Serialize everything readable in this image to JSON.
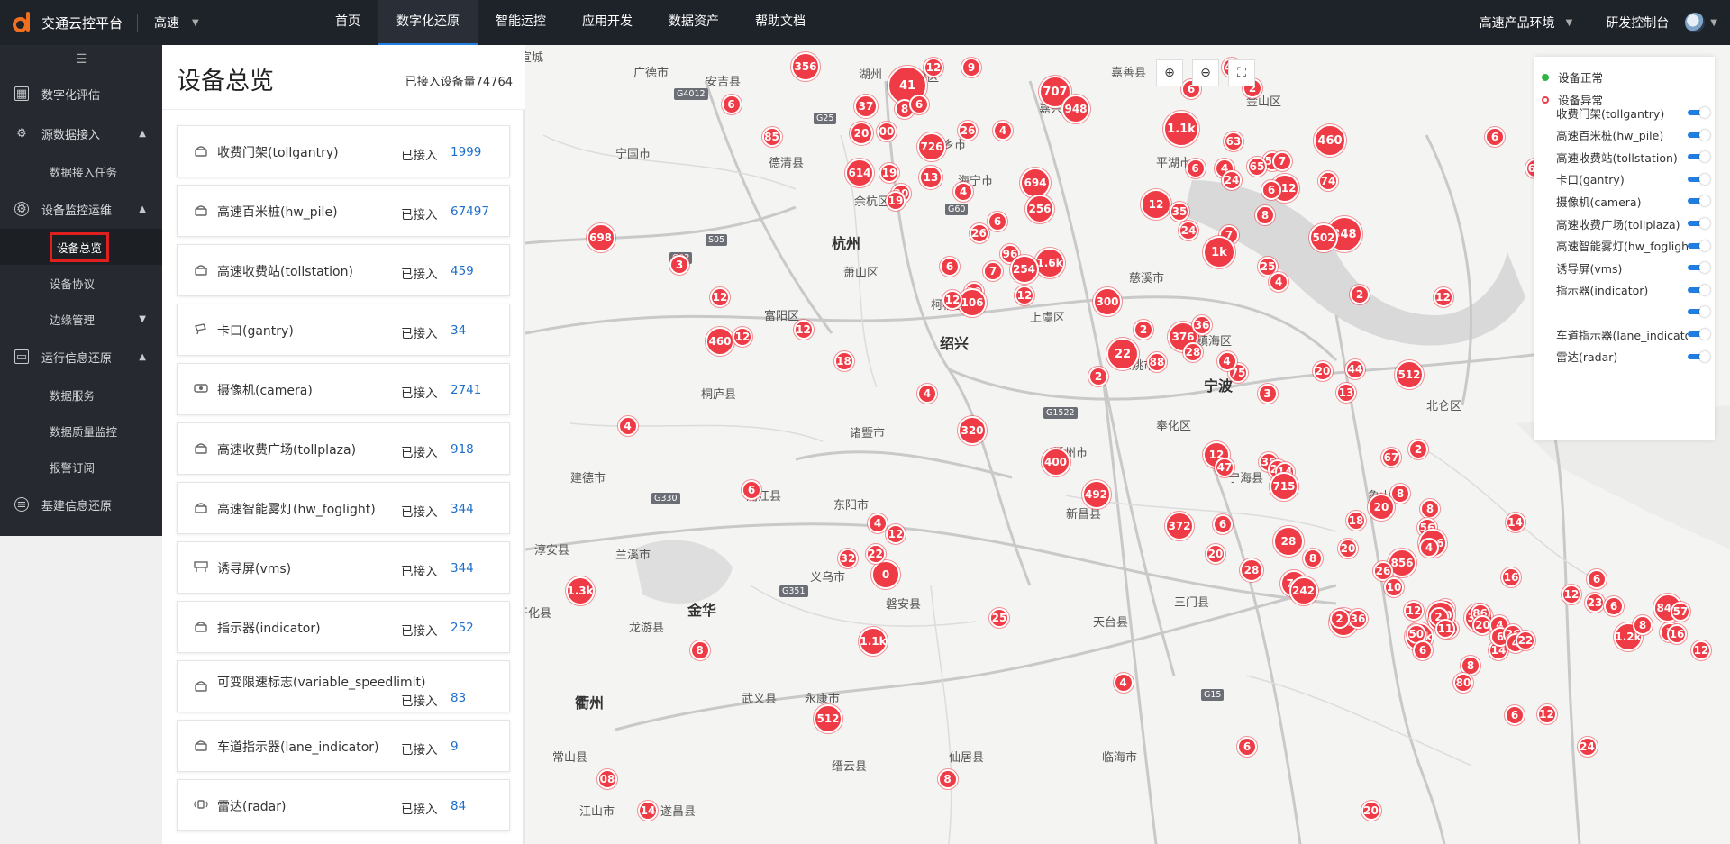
{
  "header": {
    "brand": "交通云控平台",
    "scope": "高速",
    "nav": [
      "首页",
      "数字化还原",
      "智能运控",
      "应用开发",
      "数据资产",
      "帮助文档"
    ],
    "active_nav_index": 1,
    "env": "高速产品环境",
    "console": "研发控制台"
  },
  "sidebar": {
    "groups": [
      {
        "label": "数字化评估",
        "icon": "assessment-icon",
        "expanded": false,
        "items": []
      },
      {
        "label": "源数据接入",
        "icon": "data-source-icon",
        "expanded": true,
        "items": [
          "数据接入任务"
        ]
      },
      {
        "label": "设备监控运维",
        "icon": "device-monitor-icon",
        "expanded": true,
        "items": [
          "设备总览",
          "设备协议",
          "边缘管理"
        ]
      },
      {
        "label": "运行信息还原",
        "icon": "runtime-info-icon",
        "expanded": true,
        "items": [
          "数据服务",
          "数据质量监控",
          "报警订阅"
        ]
      },
      {
        "label": "基建信息还原",
        "icon": "infrastructure-icon",
        "expanded": false,
        "items": []
      }
    ],
    "active_item": "设备总览"
  },
  "overview": {
    "title": "设备总览",
    "total": "已接入设备量74764",
    "connected_label": "已接入",
    "devices": [
      {
        "name": "收费门架(tollgantry)",
        "count": "1999"
      },
      {
        "name": "高速百米桩(hw_pile)",
        "count": "67497"
      },
      {
        "name": "高速收费站(tollstation)",
        "count": "459"
      },
      {
        "name": "卡口(gantry)",
        "count": "34"
      },
      {
        "name": "摄像机(camera)",
        "count": "2741"
      },
      {
        "name": "高速收费广场(tollplaza)",
        "count": "918"
      },
      {
        "name": "高速智能雾灯(hw_foglight)",
        "count": "344"
      },
      {
        "name": "诱导屏(vms)",
        "count": "344"
      },
      {
        "name": "指示器(indicator)",
        "count": "252"
      },
      {
        "name": "可变限速标志(variable_speedlimit)",
        "count": "83"
      },
      {
        "name": "车道指示器(lane_indicator)",
        "count": "9"
      },
      {
        "name": "雷达(radar)",
        "count": "84"
      }
    ]
  },
  "legend": {
    "normal": "设备正常",
    "abnormal": "设备异常",
    "normal_color": "#2fb344",
    "abnormal_color": "#ee3b45",
    "layers": [
      "收费门架(tollgantry)",
      "高速百米桩(hw_pile)",
      "高速收费站(tollstation)",
      "卡口(gantry)",
      "摄像机(camera)",
      "高速收费广场(tollplaza)",
      "高速智能雾灯(hw_foglight)",
      "诱导屏(vms)",
      "指示器(indicator)",
      "",
      "车道指示器(lane_indicator)",
      "雷达(radar)"
    ]
  },
  "map": {
    "places": [
      "宣城",
      "湖州",
      "南浔区",
      "嘉兴",
      "海宁市",
      "桐乡市",
      "德清县",
      "余杭区",
      "杭州",
      "萧山区",
      "富阳区",
      "桐庐县",
      "柯桥区",
      "绍兴",
      "慈溪市",
      "镇海区",
      "宁波",
      "浦江县",
      "兰溪市",
      "金华",
      "义乌市",
      "东阳市",
      "诸暨市",
      "衢州",
      "龙游县",
      "武义县",
      "永康市",
      "嵊州市",
      "新昌县",
      "象山县",
      "宁国市",
      "安吉县",
      "广德市",
      "嘉善县",
      "金山区",
      "平湖市",
      "上虞区",
      "余姚市",
      "奉化区",
      "宁海县",
      "三门县",
      "天台县",
      "磐安县",
      "淳安县",
      "建德市",
      "开化县",
      "常山县",
      "江山市",
      "遂昌县",
      "缙云县",
      "仙居县",
      "临海市",
      "北仑区"
    ],
    "highways": [
      "G4012",
      "S05",
      "G25",
      "G60",
      "G1522",
      "G92",
      "G330",
      "G351",
      "G15"
    ],
    "clusters": [
      "356",
      "41",
      "12",
      "9",
      "707",
      "49",
      "6",
      "2",
      "37",
      "8",
      "6",
      "20",
      "00",
      "726",
      "26",
      "4",
      "1.1k",
      "63",
      "51",
      "4",
      "19",
      "13",
      "694",
      "24",
      "65",
      "7",
      "460",
      "20",
      "4",
      "256",
      "74",
      "512",
      "12",
      "6",
      "35",
      "8",
      "7",
      "24",
      "348",
      "6",
      "1k",
      "96",
      "1.6k",
      "20",
      "106",
      "杭州",
      "6",
      "25",
      "4",
      "2",
      "12",
      "7",
      "12",
      "460",
      "22",
      "12",
      "376",
      "36",
      "88",
      "28",
      "75",
      "20",
      "512",
      "2",
      "44",
      "13",
      "2",
      "12",
      "47",
      "35",
      "22",
      "14",
      "715",
      "6",
      "28",
      "8",
      "20",
      "8",
      "18",
      "12",
      "8",
      "20",
      "856",
      "26",
      "28",
      "72",
      "428",
      "36",
      "56",
      "536",
      "4",
      "4",
      "32",
      "0",
      "12",
      "1.1k",
      "16",
      "10",
      "4",
      "31",
      "820",
      "8",
      "14",
      "6",
      "12",
      "23",
      "1.2k",
      "6",
      "6",
      "8",
      "844",
      "2",
      "16",
      "57",
      "12",
      "1.2k",
      "50",
      "2",
      "2",
      "11",
      "316",
      "86",
      "20",
      "4",
      "6",
      "26",
      "4",
      "22",
      "60",
      "698",
      "12",
      "18",
      "320",
      "492",
      "20",
      "2",
      "80",
      "24",
      "14",
      "85",
      "19",
      "254",
      "2",
      "3",
      "67",
      "14",
      "1.3k",
      "8",
      "512",
      "8",
      "948",
      "6",
      "502",
      "12",
      "62",
      "4",
      "6",
      "22",
      "25",
      "4",
      "6",
      "20",
      "6",
      "12",
      "3",
      "12",
      "4",
      "400",
      "372",
      "242",
      "6",
      "12",
      "08",
      "6",
      "614",
      "26",
      "300",
      "4"
    ]
  }
}
